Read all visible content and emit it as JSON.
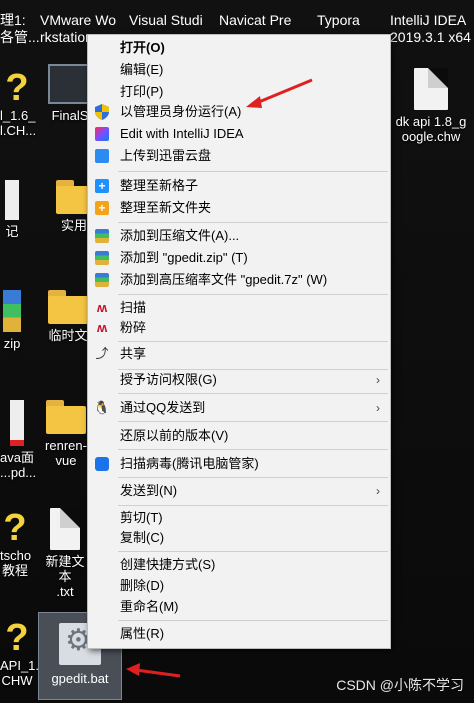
{
  "desktop": {
    "top_labels": [
      "理1:\n各管...",
      "VMware Wo\nrkstation",
      "Visual Studi",
      "Navicat Pre",
      "Typora",
      "IntelliJ IDEA\n2019.3.1 x64"
    ],
    "left_col": [
      {
        "label": "l_1.6_\nl.CH...",
        "kind": "qmark"
      },
      {
        "label": "记",
        "kind": "doc"
      },
      {
        "label": "zip",
        "kind": "zip"
      },
      {
        "label": "ava面\n...pd...",
        "kind": "pdf"
      },
      {
        "label": "tscho\n教程",
        "kind": "qmark"
      },
      {
        "label": "API_1.\nCHW",
        "kind": "qmark"
      }
    ],
    "second_col": [
      {
        "label": "FinalS",
        "kind": "app"
      },
      {
        "label": "实用",
        "kind": "folder"
      },
      {
        "label": "临时文",
        "kind": "folder"
      },
      {
        "label": "renren-\nvue",
        "kind": "folder"
      },
      {
        "label": "新建文本\n.txt",
        "kind": "doc"
      }
    ],
    "right_icon": {
      "label": "dk api 1.8_g\noogle.chw"
    },
    "selected_file": {
      "label": "gpedit.bat"
    }
  },
  "context_menu": {
    "items": [
      {
        "label": "打开(O)",
        "icon": "none",
        "bold": true
      },
      {
        "label": "编辑(E)",
        "icon": "none"
      },
      {
        "label": "打印(P)",
        "icon": "none"
      },
      {
        "label": "以管理员身份运行(A)",
        "icon": "uac-shield-icon"
      },
      {
        "label": "Edit with IntelliJ IDEA",
        "icon": "intellij-icon"
      },
      {
        "label": "上传到迅雷云盘",
        "icon": "thunder-cloud-icon"
      },
      {
        "label": "整理至新格子",
        "icon": "plus-blue-icon"
      },
      {
        "label": "整理至新文件夹",
        "icon": "plus-orange-icon"
      },
      {
        "label": "添加到压缩文件(A)...",
        "icon": "archive-icon"
      },
      {
        "label": "添加到 \"gpedit.zip\" (T)",
        "icon": "archive-icon"
      },
      {
        "label": "添加到高压缩率文件 \"gpedit.7z\" (W)",
        "icon": "archive-icon"
      },
      {
        "label": "扫描",
        "icon": "mcafee-icon"
      },
      {
        "label": "粉碎",
        "icon": "mcafee-icon"
      },
      {
        "label": "共享",
        "icon": "share-icon"
      },
      {
        "label": "授予访问权限(G)",
        "icon": "none",
        "submenu": true
      },
      {
        "label": "通过QQ发送到",
        "icon": "qq-icon",
        "submenu": true
      },
      {
        "label": "还原以前的版本(V)",
        "icon": "none"
      },
      {
        "label": "扫描病毒(腾讯电脑管家)",
        "icon": "tencent-shield-icon"
      },
      {
        "label": "发送到(N)",
        "icon": "none",
        "submenu": true
      },
      {
        "label": "剪切(T)",
        "icon": "none"
      },
      {
        "label": "复制(C)",
        "icon": "none"
      },
      {
        "label": "创建快捷方式(S)",
        "icon": "none"
      },
      {
        "label": "删除(D)",
        "icon": "none"
      },
      {
        "label": "重命名(M)",
        "icon": "none"
      },
      {
        "label": "属性(R)",
        "icon": "none"
      }
    ],
    "arrow_glyph": "›"
  },
  "watermark": "CSDN @小陈不学习",
  "colors": {
    "menu_bg": "#f2f2f2",
    "annotation": "#e02020",
    "selection": "#4a4f57"
  }
}
